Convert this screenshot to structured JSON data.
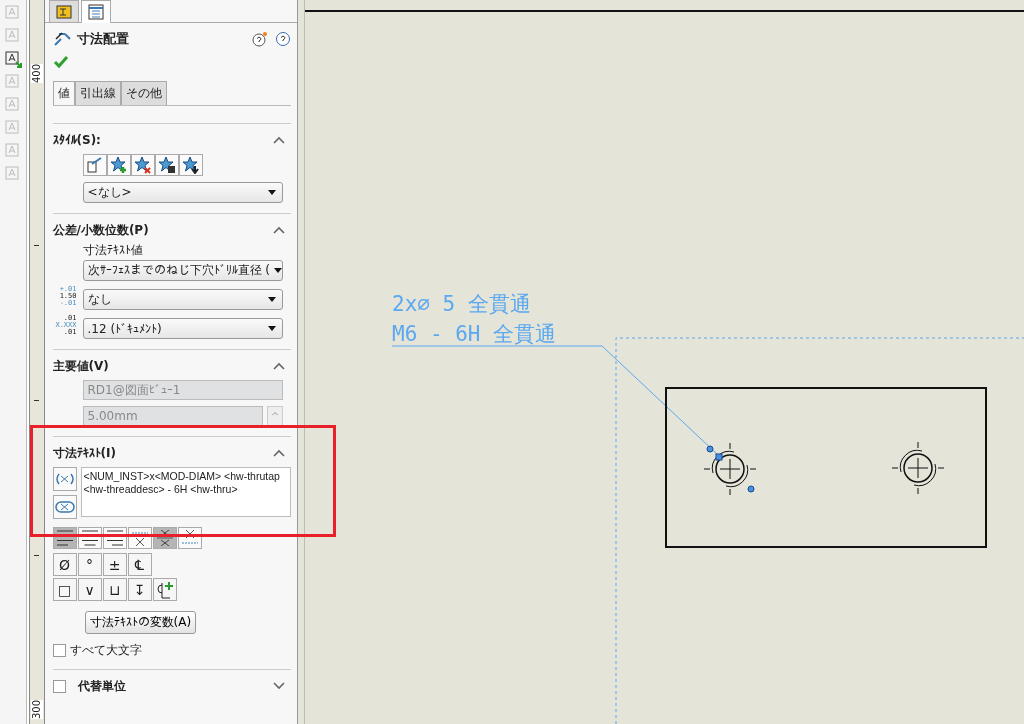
{
  "ruler": {
    "labels": [
      "400",
      "300"
    ]
  },
  "panel_tabs": [
    {
      "kind": "property",
      "selected": false
    },
    {
      "kind": "list",
      "selected": true
    }
  ],
  "header": {
    "title": "寸法配置"
  },
  "value_tabs": [
    {
      "label": "値",
      "selected": true
    },
    {
      "label": "引出線",
      "selected": false
    },
    {
      "label": "その他",
      "selected": false
    }
  ],
  "style_section": {
    "title": "ｽﾀｲﾙ(S):",
    "expanded": true,
    "dropdown": "<なし>"
  },
  "tolerance_section": {
    "title": "公差/小数位数(P)",
    "expanded": true,
    "text_value_label": "寸法ﾃｷｽﾄ値",
    "text_value": "次ｻｰﾌｪｽまでのねじ下穴ﾄﾞﾘﾙ直径 (",
    "tolerance_icon": [
      "+.01",
      "1.50",
      "-.01"
    ],
    "tolerance": "なし",
    "precision_icon": [
      ".01",
      "X.XXX",
      ".01"
    ],
    "precision": ".12 (ﾄﾞｷｭﾒﾝﾄ)"
  },
  "primary_section": {
    "title": "主要値(V)",
    "expanded": true,
    "fields": [
      {
        "value": "RD1@図面ﾋﾞｭｰ1",
        "disabled": true
      },
      {
        "value": "5.00mm",
        "disabled": true
      }
    ]
  },
  "text_section": {
    "title": "寸法ﾃｷｽﾄ(I)",
    "expanded": true,
    "value": "<NUM_INST>x<MOD-DIAM> <hw-thrutap\n<hw-threaddesc> - 6H <hw-thru>"
  },
  "align_buttons": [
    {
      "kind": "left",
      "selected": true
    },
    {
      "kind": "center",
      "selected": false
    },
    {
      "kind": "right",
      "selected": false
    },
    {
      "kind": "above",
      "selected": false
    },
    {
      "kind": "middle",
      "selected": true
    },
    {
      "kind": "below",
      "selected": false
    }
  ],
  "symbols": [
    "Ø",
    "°",
    "±",
    "℄",
    "□",
    "∨",
    "⊔",
    "↧"
  ],
  "variables_button": "寸法ﾃｷｽﾄの変数(A)",
  "all_caps": {
    "label": "すべて大文字",
    "checked": false
  },
  "dual_units": {
    "label": "代替単位",
    "checked": false,
    "expanded": false
  },
  "drawing": {
    "callout_lines": [
      "2x∅ 5 全貫通",
      "M6 - 6H 全貫通"
    ]
  }
}
